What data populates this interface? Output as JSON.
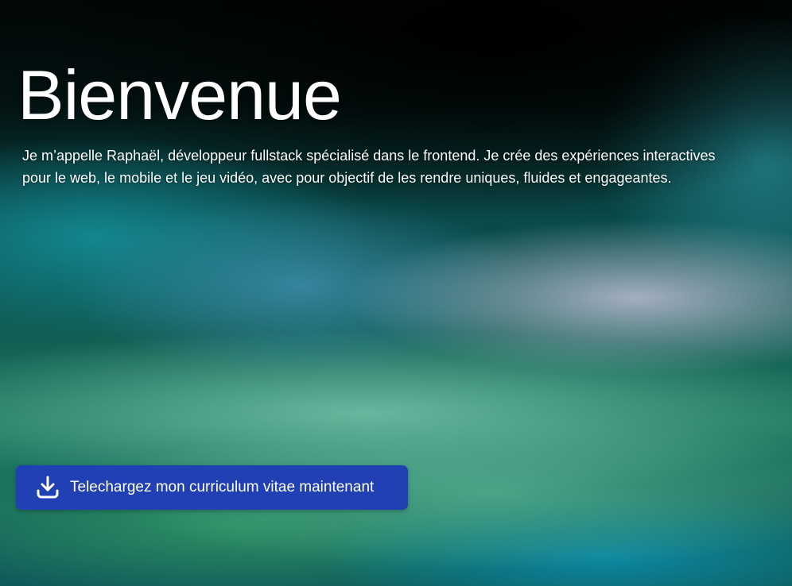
{
  "hero": {
    "title": "Bienvenue",
    "intro": "Je m’appelle Raphaël, développeur fullstack spécialisé dans le frontend. Je crée des expériences interactives pour le web, le mobile et le jeu vidéo, avec pour objectif de les rendre uniques, fluides et engageantes."
  },
  "cv_button": {
    "label": "Telechargez mon curriculum vitae maintenant",
    "icon": "download-icon",
    "color": "#2140b3"
  }
}
